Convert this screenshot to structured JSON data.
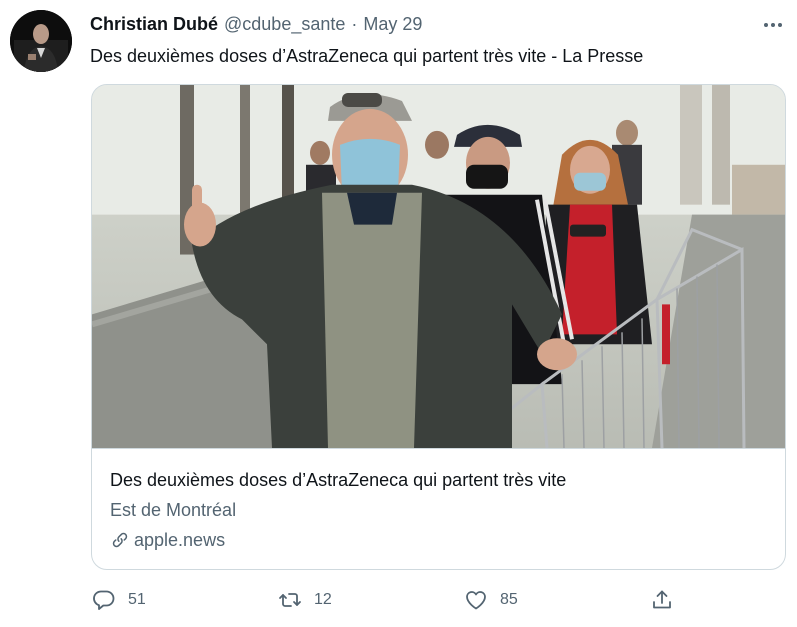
{
  "tweet": {
    "author_name": "Christian Dubé",
    "author_handle": "@cdube_sante",
    "separator": "·",
    "date": "May 29",
    "text": "Des deuxièmes doses d’AstraZeneca qui partent très vite - La Presse"
  },
  "card": {
    "title": "Des deuxièmes doses d’AstraZeneca qui partent très vite",
    "source": "Est de Montréal",
    "domain": "apple.news"
  },
  "actions": {
    "reply_count": "51",
    "retweet_count": "12",
    "like_count": "85"
  },
  "icons": {
    "more": "more-horizontal-icon",
    "reply": "reply-bubble-icon",
    "retweet": "retweet-icon",
    "like": "heart-icon",
    "share": "share-icon",
    "link": "link-icon"
  },
  "colors": {
    "text_primary": "#0f1419",
    "text_secondary": "#536471",
    "border": "#cfd9de"
  }
}
